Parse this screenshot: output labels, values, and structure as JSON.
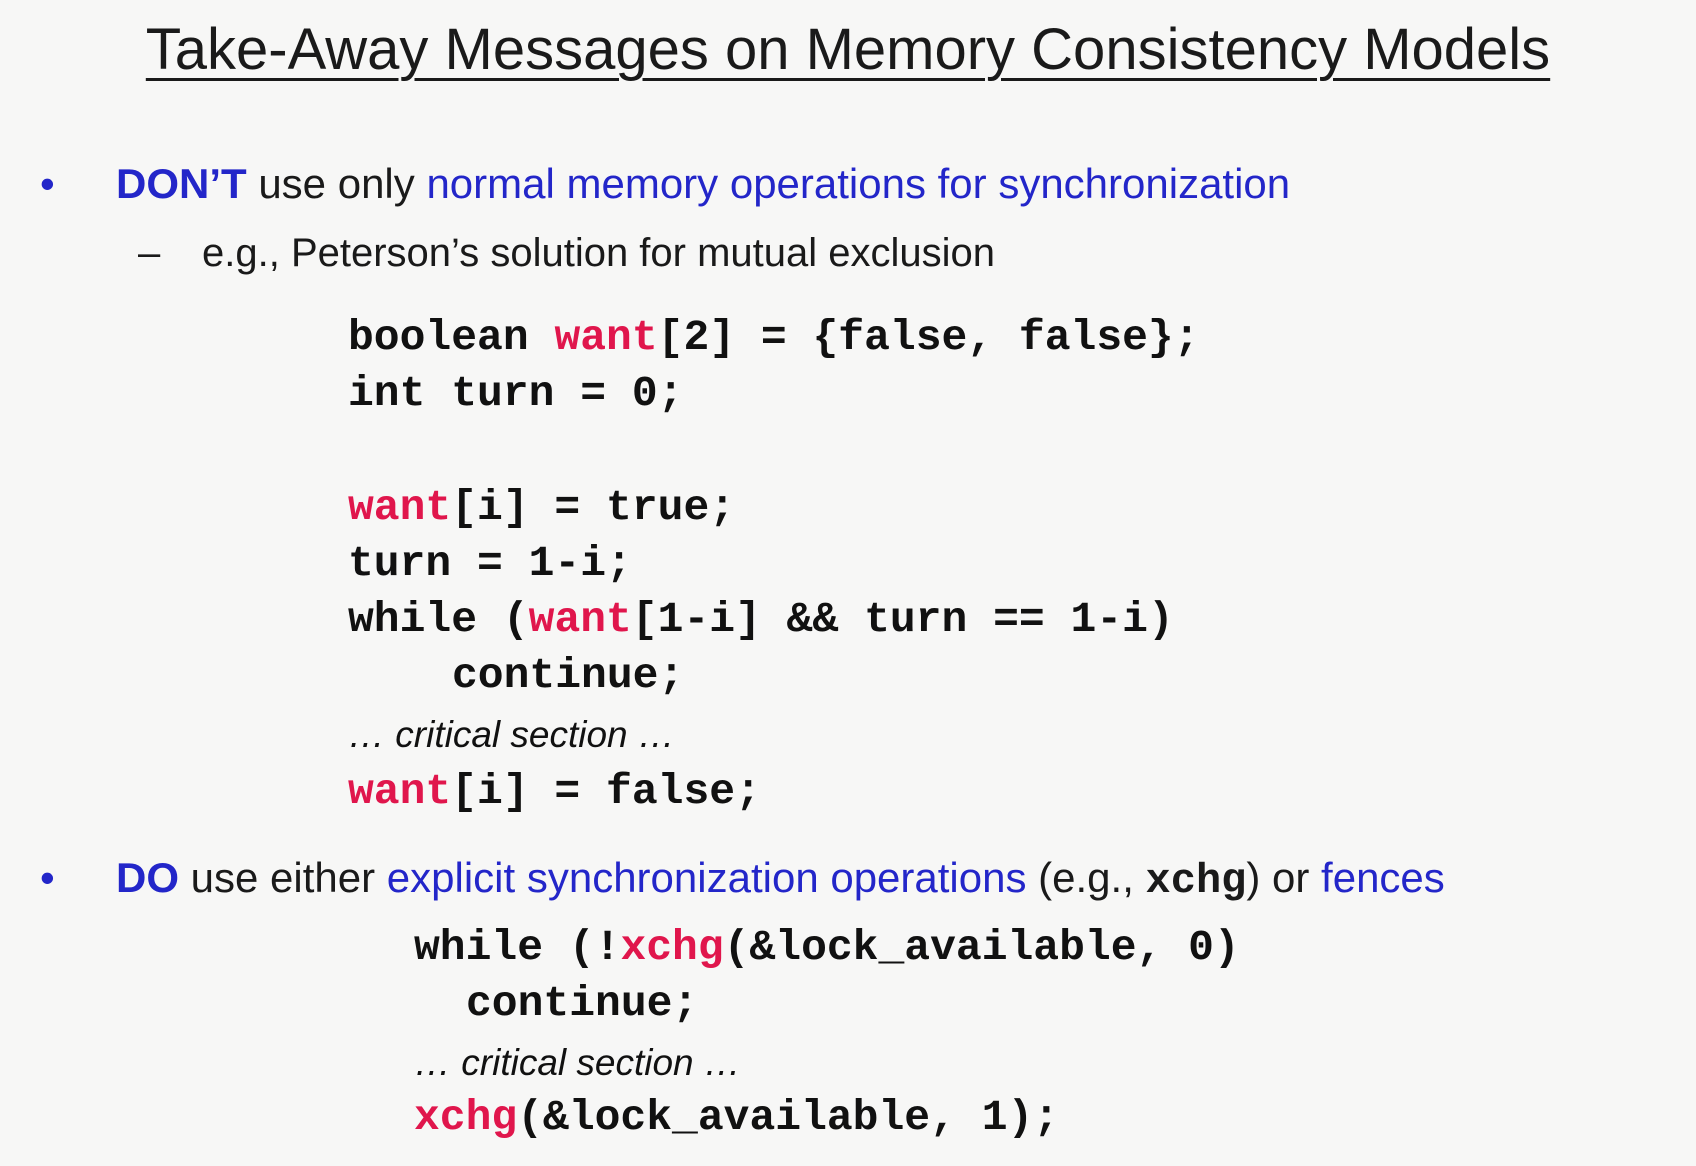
{
  "slide": {
    "title": "Take-Away Messages on Memory Consistency Models",
    "bullet1": {
      "marker": "•",
      "lead": "DON’T",
      "text1": " use only ",
      "highlight": "normal memory operations for synchronization",
      "sub": {
        "marker": "–",
        "text": "e.g., Peterson’s solution for mutual exclusion"
      }
    },
    "code1": {
      "l1_kw": "boolean ",
      "l1_hl": "want",
      "l1_rest": "[2] = {false, false};",
      "l2": "int turn = 0;",
      "l3_hl": "want",
      "l3_rest": "[i] = true;",
      "l4": "turn = 1-i;",
      "l5_a": "while (",
      "l5_hl": "want",
      "l5_b": "[1-i] && turn == 1-i)",
      "l6": "continue;",
      "comment": "… critical section …",
      "l8_hl": "want",
      "l8_rest": "[i] = false;"
    },
    "bullet2": {
      "marker": "•",
      "lead": "DO",
      "text1": " use either ",
      "highlight1": "explicit synchronization operations",
      "text2": " (e.g., ",
      "code": "xchg",
      "text3": ") or ",
      "highlight2": "fences"
    },
    "code2": {
      "l1_a": "while (!",
      "l1_hl": "xchg",
      "l1_b": "(&lock_available, 0)",
      "l2": "continue;",
      "comment": "… critical section …",
      "l4_hl": "xchg",
      "l4_rest": "(&lock_available, 1);"
    }
  }
}
